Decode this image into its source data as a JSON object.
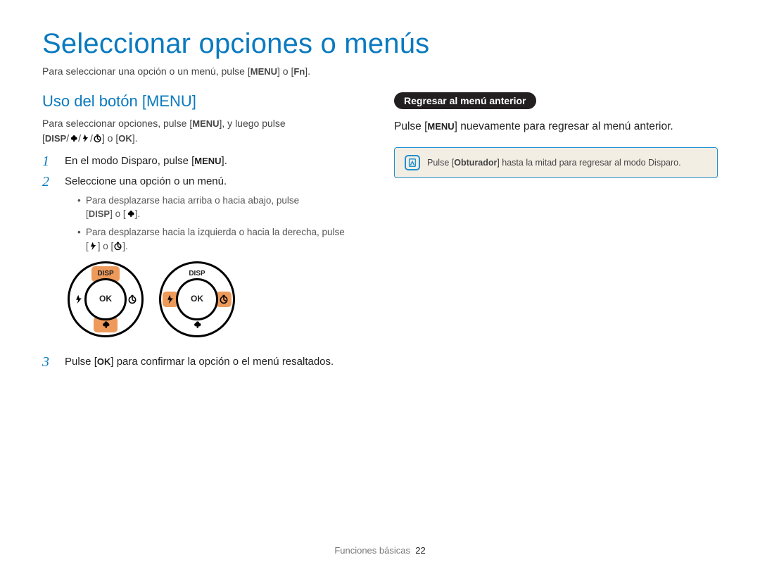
{
  "title": "Seleccionar opciones o menús",
  "intro": {
    "pre": "Para seleccionar una opción o un menú, pulse [",
    "key1": "MENU",
    "mid": "] o [",
    "key2": "Fn",
    "post": "]."
  },
  "left": {
    "heading": "Uso del botón [MENU]",
    "lead_pre": "Para seleccionar opciones, pulse [",
    "lead_key": "MENU",
    "lead_post": "], y luego pulse",
    "lead2_open": "[",
    "lead2_disp": "DISP",
    "lead2_sep": "/",
    "lead2_mid1": "/",
    "lead2_mid2": "/",
    "lead2_or": "] o [",
    "lead2_ok": "OK",
    "lead2_close": "].",
    "steps": [
      {
        "n": "1",
        "pre": "En el modo Disparo, pulse [",
        "key": "MENU",
        "post": "]."
      },
      {
        "n": "2",
        "text": "Seleccione una opción o un menú.",
        "b1_pre": "Para desplazarse hacia arriba o hacia abajo, pulse",
        "b1_open": "[",
        "b1_key1": "DISP",
        "b1_or": "] o [",
        "b1_close": "].",
        "b2_pre": "Para desplazarse hacia la izquierda o hacia la derecha, pulse",
        "b2_open": "[",
        "b2_or": "] o [",
        "b2_close": "]."
      },
      {
        "n": "3",
        "pre": "Pulse [",
        "key": "OK",
        "post": "] para confirmar la opción o el menú resaltados."
      }
    ],
    "dial": {
      "top": "DISP",
      "center": "OK"
    }
  },
  "right": {
    "chip": "Regresar al menú anterior",
    "line_pre": "Pulse [",
    "line_key": "MENU",
    "line_post": "] nuevamente para regresar al menú anterior.",
    "note_pre": "Pulse [",
    "note_key": "Obturador",
    "note_post": "] hasta la mitad para regresar al modo Disparo."
  },
  "footer": {
    "section": "Funciones básicas",
    "page": "22"
  }
}
